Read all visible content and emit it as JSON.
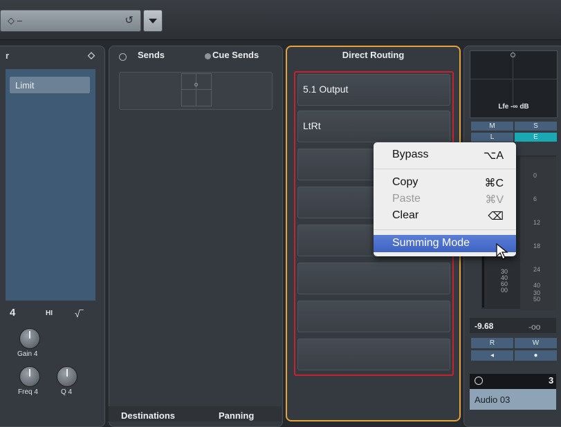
{
  "topbar": {
    "preset_value": "◇ –",
    "reset_icon": "↺"
  },
  "eq": {
    "header_partial": "r",
    "header_icon": "◇",
    "limit_label": "Limit",
    "band_number": "4",
    "hi_label": "HI",
    "gain_label": "Gain 4",
    "freq_label": "Freq 4",
    "q_label": "Q 4"
  },
  "sends": {
    "tab_sends": "Sends",
    "tab_cue_sends": "Cue Sends",
    "footer_destinations": "Destinations",
    "footer_panning": "Panning"
  },
  "routing": {
    "title": "Direct Routing",
    "slots": [
      "5.1 Output",
      "LtRt",
      "",
      "",
      "",
      "",
      "",
      ""
    ]
  },
  "channel": {
    "lfe_label": "Lfe -∞ dB",
    "m": "M",
    "s": "S",
    "l": "L",
    "e": "E",
    "scale_right": [
      "0",
      "6",
      "12",
      "18",
      "24",
      "30",
      "40",
      "50"
    ],
    "scale_left": [
      "30",
      "40",
      "60",
      "00"
    ],
    "readout_left": "-9.68",
    "readout_right": "-oo",
    "r": "R",
    "w": "W",
    "channel_number": "3",
    "channel_name": "Audio 03"
  },
  "menu": {
    "bypass": "Bypass",
    "bypass_shortcut": "⌥A",
    "copy": "Copy",
    "copy_shortcut": "⌘C",
    "paste": "Paste",
    "paste_shortcut": "⌘V",
    "clear": "Clear",
    "clear_shortcut": "⌫",
    "summing": "Summing Mode"
  },
  "colors": {
    "accent_orange": "#e3a43a",
    "routing_red": "#c7222d",
    "menu_highlight": "#4a6fcf"
  }
}
